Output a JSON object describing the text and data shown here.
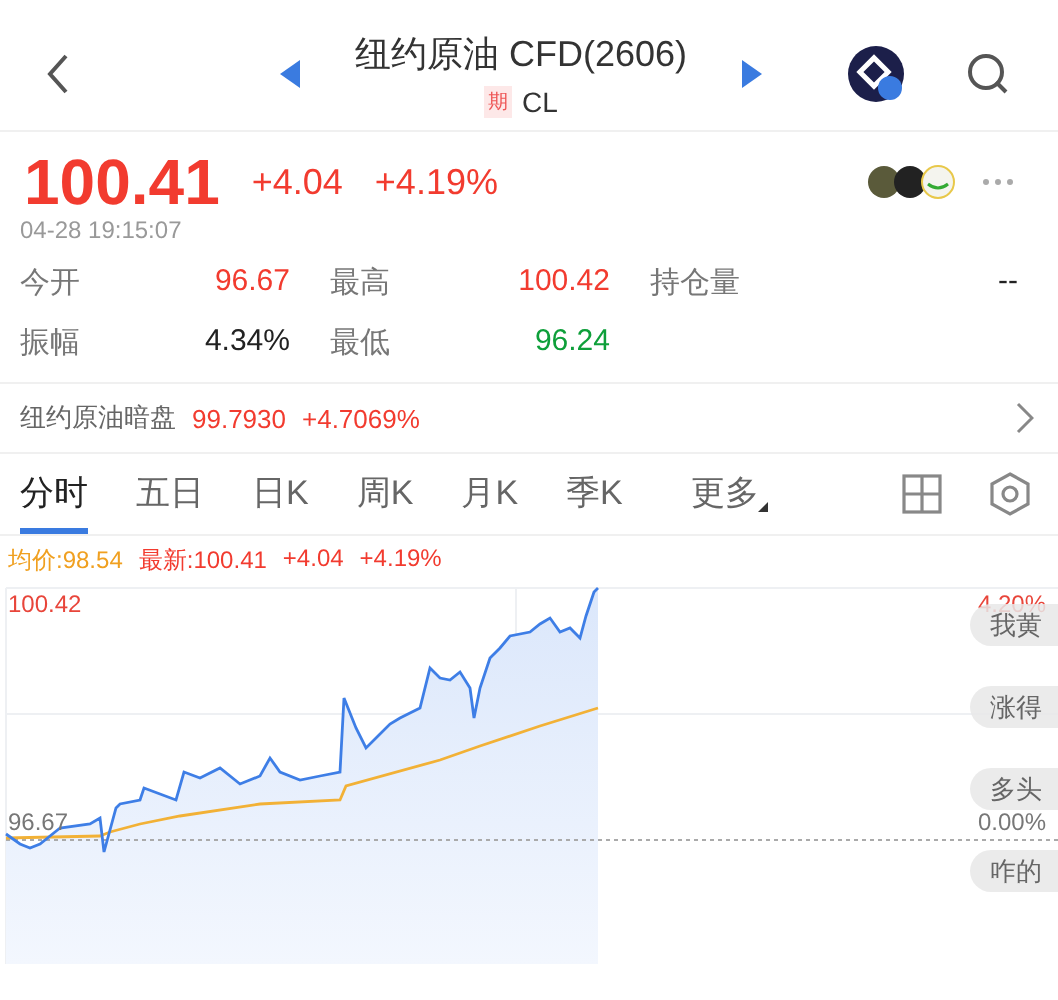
{
  "header": {
    "title": "纽约原油 CFD(2606)",
    "tag": "期",
    "code": "CL"
  },
  "quote": {
    "price": "100.41",
    "change": "+4.04",
    "percent": "+4.19%",
    "time": "04-28 19:15:07"
  },
  "stats": [
    {
      "label": "今开",
      "value": "96.67",
      "color": "#f23b2f"
    },
    {
      "label": "最高",
      "value": "100.42",
      "color": "#f23b2f"
    },
    {
      "label": "持仓量",
      "value": "--",
      "color": "#222222"
    },
    {
      "label": "振幅",
      "value": "4.34%",
      "color": "#222222"
    },
    {
      "label": "最低",
      "value": "96.24",
      "color": "#0e9f3a"
    }
  ],
  "dark_pool": {
    "label": "纽约原油暗盘",
    "value": "99.7930",
    "percent": "+4.7069%"
  },
  "tabs": [
    {
      "label": "分时",
      "selected": true
    },
    {
      "label": "五日",
      "selected": false
    },
    {
      "label": "日K",
      "selected": false
    },
    {
      "label": "周K",
      "selected": false
    },
    {
      "label": "月K",
      "selected": false
    },
    {
      "label": "季K",
      "selected": false
    },
    {
      "label": "更多",
      "selected": false
    }
  ],
  "legend": {
    "average": "均价:98.54",
    "latest": "最新:100.41",
    "change": "+4.04",
    "percent": "+4.19%"
  },
  "chart": {
    "top_price": "100.42",
    "top_percent": "4.20%",
    "base_price": "96.67",
    "base_percent": "0.00%"
  },
  "comments": [
    "我黄",
    "涨得",
    "多头",
    "咋的"
  ]
}
